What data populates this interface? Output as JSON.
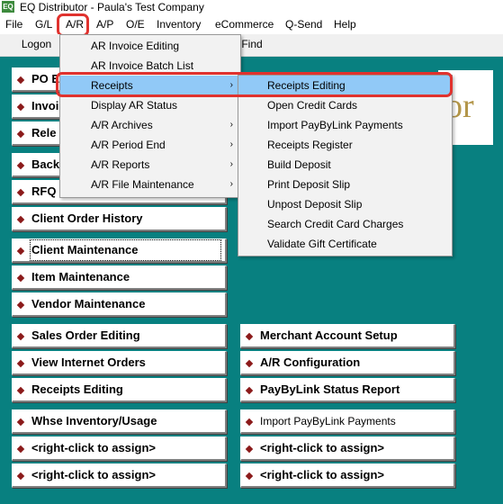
{
  "window": {
    "title": "EQ Distributor - Paula's Test Company",
    "icon": "eq-app-icon"
  },
  "menubar": [
    "File",
    "G/L",
    "A/R",
    "A/P",
    "O/E",
    "Inventory",
    "eCommerce",
    "Q-Send",
    "Help"
  ],
  "toolbar": {
    "logon": "Logon",
    "find": "Find"
  },
  "left_buttons": [
    "PO E",
    "Invoi",
    "Rele",
    "Back",
    "RFQ",
    "Client Order History",
    "Client Maintenance",
    "Item Maintenance",
    "Vendor Maintenance",
    "Sales Order Editing",
    "View Internet Orders",
    "Receipts Editing",
    "Whse Inventory/Usage",
    "<right-click to assign>",
    "<right-click to assign>"
  ],
  "right_buttons": [
    "Merchant Account Setup",
    "A/R Configuration",
    "PayByLink Status Report",
    "Import PayByLink Payments",
    "<right-click to assign>",
    "<right-click to assign>"
  ],
  "logo": {
    "text": "or",
    "color": "#b3964a"
  },
  "ar_menu": [
    "AR Invoice Editing",
    "AR Invoice Batch List",
    "Receipts",
    "Display AR Status",
    "A/R Archives",
    "A/R Period End",
    "A/R Reports",
    "A/R File Maintenance"
  ],
  "receipts_submenu": [
    "Receipts Editing",
    "Open Credit Cards",
    "Import PayByLink Payments",
    "Receipts Register",
    "Build Deposit",
    "Print Deposit Slip",
    "Unpost Deposit Slip",
    "Search Credit Card Charges",
    "Validate Gift Certificate"
  ],
  "colors": {
    "background": "#088080",
    "highlight": "#91c9f7",
    "annotation_ring": "#e0322e",
    "bullet": "#8b1a1a"
  }
}
